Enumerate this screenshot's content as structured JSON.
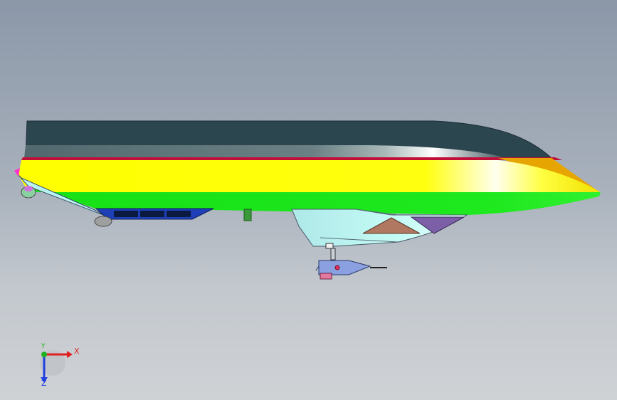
{
  "viewport": {
    "background_top": "#8b97a8",
    "background_bottom": "#cfd2d5"
  },
  "model": {
    "name": "boat-hull",
    "colors": {
      "deck_dark": "#2c4650",
      "deck_band": "#5f7579",
      "stripe_red": "#c0103a",
      "stripe_yellow": "#ffff00",
      "stripe_green": "#19e619",
      "hull_lower": "#b9f5f0",
      "keel_blue": "#1f3fb8",
      "brown_panel": "#b07860",
      "purple_panel": "#7d5fa8",
      "bow_accent": "#e6a500",
      "motor_body": "#8aa0e0",
      "motor_base": "#e27aa0",
      "strut": "#3a9a3a"
    }
  },
  "triad": {
    "x_label": "X",
    "y_label": "Y",
    "z_label": "Z",
    "x_color": "#e02020",
    "y_color": "#20b020",
    "z_color": "#2040e0"
  }
}
